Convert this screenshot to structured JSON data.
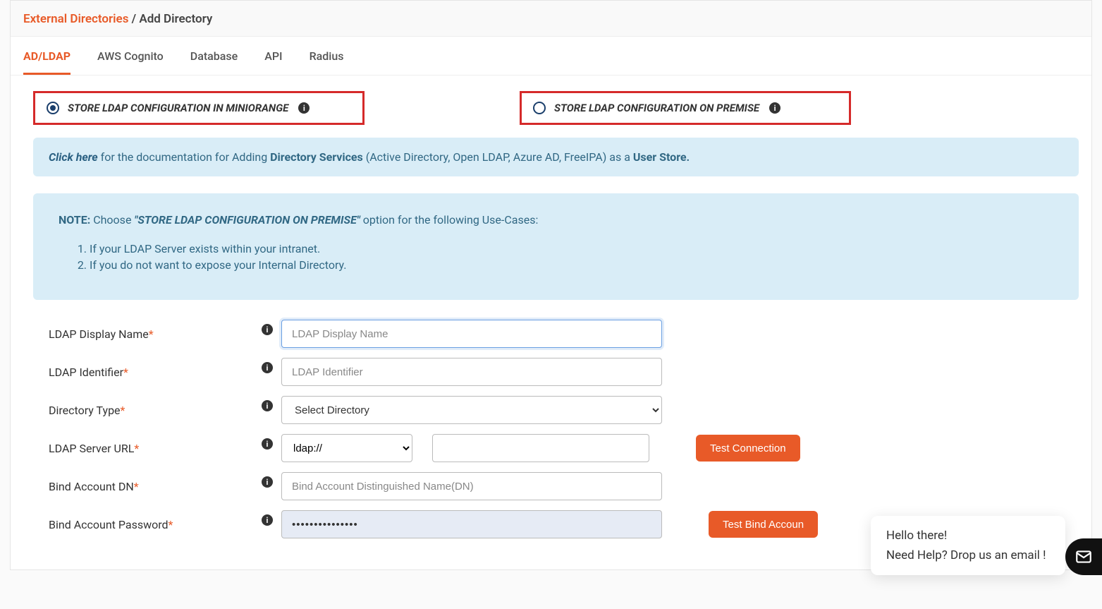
{
  "breadcrumb": {
    "parent": "External Directories",
    "sep": "/",
    "current": "Add Directory"
  },
  "tabs": {
    "adldap": "AD/LDAP",
    "awscognito": "AWS Cognito",
    "database": "Database",
    "api": "API",
    "radius": "Radius"
  },
  "radios": {
    "miniorange": "STORE LDAP CONFIGURATION IN MINIORANGE",
    "onpremise": "STORE LDAP CONFIGURATION ON PREMISE"
  },
  "alert": {
    "click_here": "Click here",
    "mid1": " for the documentation for Adding ",
    "strong1": "Directory Services",
    "mid2": " (Active Directory, Open LDAP, Azure AD, FreeIPA) as a ",
    "strong2": "User Store."
  },
  "note": {
    "label": "NOTE:",
    "lead1": " Choose ",
    "emph": "\"STORE LDAP CONFIGURATION ON PREMISE\"",
    "lead2": " option for the following Use-Cases:",
    "li1": "If your LDAP Server exists within your intranet.",
    "li2": "If you do not want to expose your Internal Directory."
  },
  "form": {
    "required_mark": "*",
    "ldap_display_name": {
      "label": "LDAP Display Name",
      "placeholder": "LDAP Display Name",
      "value": ""
    },
    "ldap_identifier": {
      "label": "LDAP Identifier",
      "placeholder": "LDAP Identifier",
      "value": ""
    },
    "directory_type": {
      "label": "Directory Type",
      "selected": "Select Directory"
    },
    "ldap_server_url": {
      "label": "LDAP Server URL",
      "proto": "ldap://",
      "host": ""
    },
    "bind_dn": {
      "label": "Bind Account DN",
      "placeholder": "Bind Account Distinguished Name(DN)",
      "value": ""
    },
    "bind_pwd": {
      "label": "Bind Account Password",
      "value": "•••••••••••••••"
    },
    "test_connection": "Test Connection",
    "test_bind": "Test Bind Accoun"
  },
  "chat": {
    "line1": "Hello there!",
    "line2": "Need Help? Drop us an email !"
  },
  "icons": {
    "info_glyph": "i"
  }
}
